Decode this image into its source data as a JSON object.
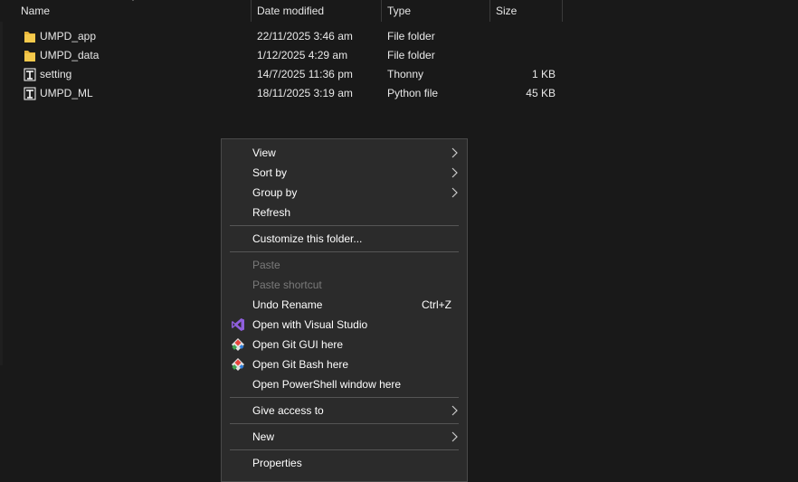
{
  "columns": {
    "name": "Name",
    "date": "Date modified",
    "type": "Type",
    "size": "Size"
  },
  "files": [
    {
      "name": "UMPD_app",
      "date": "22/11/2025 3:46 am",
      "type": "File folder",
      "size": "",
      "icon": "folder-icon"
    },
    {
      "name": "UMPD_data",
      "date": "1/12/2025 4:29 am",
      "type": "File folder",
      "size": "",
      "icon": "folder-icon"
    },
    {
      "name": "setting",
      "date": "14/7/2025 11:36 pm",
      "type": "Thonny",
      "size": "1 KB",
      "icon": "thonny-file-icon"
    },
    {
      "name": "UMPD_ML",
      "date": "18/11/2025 3:19 am",
      "type": "Python file",
      "size": "45 KB",
      "icon": "thonny-file-icon"
    }
  ],
  "menu": {
    "view": "View",
    "sort_by": "Sort by",
    "group_by": "Group by",
    "refresh": "Refresh",
    "customize": "Customize this folder...",
    "paste": "Paste",
    "paste_shortcut": "Paste shortcut",
    "undo_rename": "Undo Rename",
    "undo_shortcut": "Ctrl+Z",
    "open_vs": "Open with Visual Studio",
    "open_git_gui": "Open Git GUI here",
    "open_git_bash": "Open Git Bash here",
    "open_powershell": "Open PowerShell window here",
    "give_access": "Give access to",
    "new": "New",
    "properties": "Properties"
  },
  "colors": {
    "background": "#191919",
    "menu_background": "#2b2b2b",
    "folder": "#f4c94c",
    "vs_purple": "#8f5fdd",
    "disabled_text": "#7a7a7a"
  }
}
